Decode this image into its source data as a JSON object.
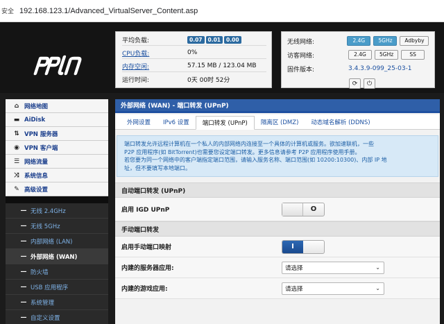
{
  "browser": {
    "security_label": "安全",
    "url": "192.168.123.1/Advanced_VirtualServer_Content.asp"
  },
  "status": [
    {
      "label": "平均负载:",
      "badges": [
        "0.07",
        "0.01",
        "0.00"
      ]
    },
    {
      "label": "CPU负载:",
      "value": "0%"
    },
    {
      "label": "内存空闲:",
      "value": "57.15 MB / 123.04 MB"
    },
    {
      "label": "运行时间:",
      "value": "0天 00时 52分"
    }
  ],
  "sysinfo": {
    "wireless_label": "无线网络:",
    "wireless_buttons": [
      "2.4G",
      "5GHz",
      "Adbyby"
    ],
    "guest_label": "访客网络:",
    "guest_buttons": [
      "2.4G",
      "5GHz",
      "SS"
    ],
    "firmware_label": "固件版本:",
    "firmware_value": "3.4.3.9-099_25-03-1",
    "refresh_icon": "refresh-icon",
    "power_icon": "power-icon"
  },
  "sidebar": {
    "items": [
      {
        "label": "网络地图",
        "icon": "home-icon"
      },
      {
        "label": "AiDisk",
        "icon": "disk-icon"
      },
      {
        "label": "VPN 服务器",
        "icon": "swap-icon"
      },
      {
        "label": "VPN 客户端",
        "icon": "globe-icon"
      },
      {
        "label": "网络流量",
        "icon": "list-icon"
      },
      {
        "label": "系统信息",
        "icon": "shuffle-icon"
      },
      {
        "label": "高级设置",
        "icon": "wrench-icon"
      }
    ],
    "subitems": [
      "无线 2.4GHz",
      "无线 5GHz",
      "内部网络 (LAN)",
      "外部网络 (WAN)",
      "防火墙",
      "USB 应用程序",
      "系统管理",
      "自定义设置"
    ],
    "active_sub": 3
  },
  "main": {
    "title": "外部网络 (WAN) - 端口转发 (UPnP)",
    "tabs": [
      "外网设置",
      "IPv6 设置",
      "端口转发 (UPnP)",
      "隔离区 (DMZ)",
      "动态域名解析 (DDNS)"
    ],
    "active_tab": 2,
    "info_lines": [
      "端口转发允许远程计算机在一个私人的内部网络内连接至一个具体的计算机或服务。欲加速联机，一些",
      "P2P 应用程序(如 BitTorrent)也需要您设定端口转发。更多信息请参考 P2P 应用程序使用手册。",
      "若您要为同一个网络中的客户端指定端口范围，请输入服务名称、端口范围(如 10200:10300)、内部 IP 地",
      "址，但不要填写本地端口。"
    ],
    "section_upnp": "自动端口转发 (UPnP)",
    "upnp_label": "启用 IGD UPnP",
    "upnp_toggle_text": "O",
    "upnp_enabled": false,
    "section_manual": "手动端口转发",
    "manual_label": "启用手动端口映射",
    "manual_toggle_text": "I",
    "manual_enabled": true,
    "server_app_label": "内建的服务器应用:",
    "server_app_value": "请选择",
    "game_app_label": "内建的游戏应用:",
    "game_app_value": "请选择"
  }
}
